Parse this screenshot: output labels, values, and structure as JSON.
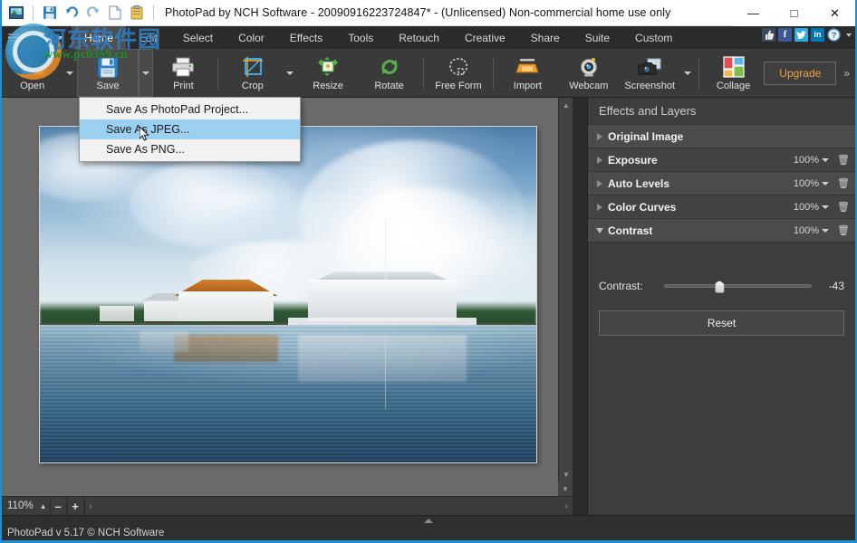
{
  "window": {
    "title": "PhotoPad by NCH Software - 20090916223724847* - (Unlicensed) Non-commercial home use only",
    "minimize_label": "—",
    "maximize_label": "□",
    "close_label": "✕"
  },
  "quick_access": [
    {
      "name": "app-icon",
      "glyph": "🖼"
    },
    {
      "name": "save-icon",
      "glyph": "💾"
    },
    {
      "name": "undo-icon",
      "glyph": "↶"
    },
    {
      "name": "redo-icon",
      "glyph": "↷"
    },
    {
      "name": "new-icon",
      "glyph": "🗎"
    },
    {
      "name": "paste-icon",
      "glyph": "📋"
    }
  ],
  "menubar": {
    "menu_label": "Menu",
    "tabs": [
      {
        "label": "Home",
        "active": true
      },
      {
        "label": "Edit",
        "active": false
      },
      {
        "label": "Select",
        "active": false
      },
      {
        "label": "Color",
        "active": false
      },
      {
        "label": "Effects",
        "active": false
      },
      {
        "label": "Tools",
        "active": false
      },
      {
        "label": "Retouch",
        "active": false
      },
      {
        "label": "Creative",
        "active": false
      },
      {
        "label": "Share",
        "active": false
      },
      {
        "label": "Suite",
        "active": false
      },
      {
        "label": "Custom",
        "active": false
      }
    ],
    "social": [
      {
        "name": "thumbs-up-icon",
        "glyph": "👍"
      },
      {
        "name": "facebook-icon",
        "glyph": "f"
      },
      {
        "name": "twitter-icon",
        "glyph": "🕊"
      },
      {
        "name": "linkedin-icon",
        "glyph": "in"
      },
      {
        "name": "help-icon",
        "glyph": "?"
      }
    ]
  },
  "toolbar": {
    "items": [
      {
        "label": "Open",
        "icon": "open-folder-icon",
        "has_caret": true,
        "pressed": false
      },
      {
        "label": "Save",
        "icon": "floppy-disk-icon",
        "has_caret": true,
        "pressed": true
      },
      {
        "label": "Print",
        "icon": "printer-icon",
        "has_caret": false,
        "pressed": false
      },
      {
        "label": "Crop",
        "icon": "crop-icon",
        "has_caret": true,
        "pressed": false
      },
      {
        "label": "Resize",
        "icon": "resize-arrows-icon",
        "has_caret": false,
        "pressed": false
      },
      {
        "label": "Rotate",
        "icon": "rotate-icon",
        "has_caret": false,
        "pressed": false
      },
      {
        "label": "Free Form",
        "icon": "free-form-lasso-icon",
        "has_caret": false,
        "pressed": false
      },
      {
        "label": "Import",
        "icon": "scanner-icon",
        "has_caret": false,
        "pressed": false
      },
      {
        "label": "Webcam",
        "icon": "webcam-icon",
        "has_caret": false,
        "pressed": false
      },
      {
        "label": "Screenshot",
        "icon": "camera-icon",
        "has_caret": true,
        "pressed": false
      },
      {
        "label": "Collage",
        "icon": "collage-grid-icon",
        "has_caret": false,
        "pressed": false
      }
    ],
    "upgrade_label": "Upgrade",
    "more_label": "»"
  },
  "save_menu": {
    "items": [
      {
        "label": "Save As PhotoPad Project...",
        "selected": false
      },
      {
        "label": "Save As JPEG...",
        "selected": true
      },
      {
        "label": "Save As PNG...",
        "selected": false
      }
    ]
  },
  "effects_panel": {
    "title": "Effects and Layers",
    "layers": [
      {
        "name": "Original Image",
        "opacity": "",
        "expanded": false,
        "has_delete": false
      },
      {
        "name": "Exposure",
        "opacity": "100%",
        "expanded": false,
        "has_delete": true
      },
      {
        "name": "Auto Levels",
        "opacity": "100%",
        "expanded": false,
        "has_delete": true
      },
      {
        "name": "Color Curves",
        "opacity": "100%",
        "expanded": false,
        "has_delete": true
      },
      {
        "name": "Contrast",
        "opacity": "100%",
        "expanded": true,
        "has_delete": true
      }
    ],
    "delete_icon": "trash-icon",
    "control": {
      "slider_label": "Contrast:",
      "slider_value": "-43",
      "slider_percent": 37,
      "reset_label": "Reset"
    }
  },
  "zoombar": {
    "zoom_level": "110%",
    "zoom_out_label": "–",
    "zoom_in_label": "+",
    "scroll_left": "‹",
    "scroll_right": "›"
  },
  "statusbar": {
    "text": "PhotoPad v 5.17 © NCH Software"
  },
  "watermark": {
    "chinese_text": "河东软件园",
    "url_text": "www.pc0359.cn"
  },
  "canvas": {
    "image_description": "Lakeside houses with dramatic cloudy sky reflected in calm water"
  },
  "colors": {
    "accent_blue": "#1e8fd5",
    "panel_bg": "#3d3d3d",
    "ribbon_bg": "#3a3a3a",
    "canvas_bg": "#6b6b6b",
    "menu_highlight": "#9cd0f0",
    "upgrade_text": "#f0a340"
  }
}
